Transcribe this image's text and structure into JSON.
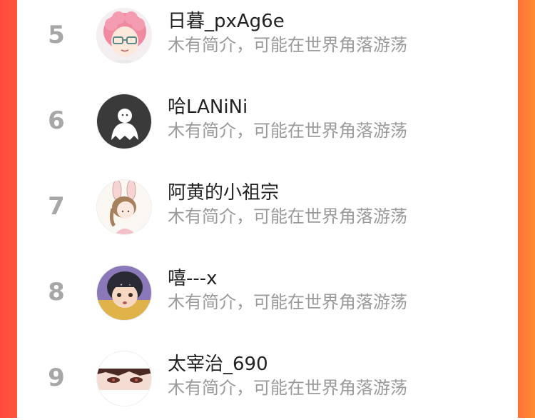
{
  "colors": {
    "background_gradient_start": "#ff4a3d",
    "background_gradient_end": "#ff8a30",
    "panel": "#ffffff",
    "rank_text": "#a7a7a7",
    "name_text": "#222222",
    "bio_text": "#9a9a9a"
  },
  "ranking_list": {
    "items": [
      {
        "rank": "5",
        "name": "日暮_pxAg6e",
        "bio": "木有简介，可能在世界角落游荡",
        "avatar_icon": "avatar-pink-hair-glasses"
      },
      {
        "rank": "6",
        "name": "哈LANiNi",
        "bio": "木有简介，可能在世界角落游荡",
        "avatar_icon": "avatar-white-ghost-dark"
      },
      {
        "rank": "7",
        "name": "阿黄的小祖宗",
        "bio": "木有简介，可能在世界角落游荡",
        "avatar_icon": "avatar-bunny-girl"
      },
      {
        "rank": "8",
        "name": "嘻---x",
        "bio": "木有简介，可能在世界角落游荡",
        "avatar_icon": "avatar-anime-boy"
      },
      {
        "rank": "9",
        "name": "太宰治_690",
        "bio": "木有简介，可能在世界角落游荡",
        "avatar_icon": "avatar-anime-eyes"
      }
    ]
  }
}
